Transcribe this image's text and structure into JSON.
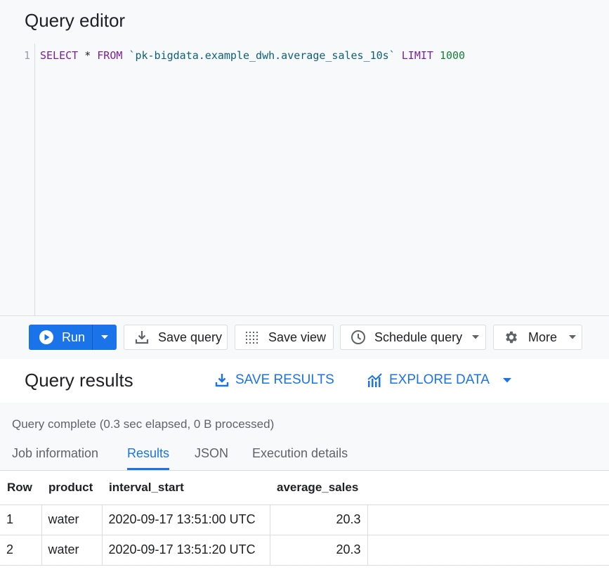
{
  "editor": {
    "title": "Query editor",
    "line_number": "1",
    "code": {
      "select": "SELECT",
      "star": "*",
      "from": "FROM",
      "table": "`pk-bigdata.example_dwh.average_sales_10s`",
      "limit": "LIMIT",
      "limit_value": "1000"
    }
  },
  "toolbar": {
    "run_label": "Run",
    "save_query_label": "Save query",
    "save_view_label": "Save view",
    "schedule_query_label": "Schedule query",
    "more_label": "More"
  },
  "results": {
    "title": "Query results",
    "save_results_label": "SAVE RESULTS",
    "explore_data_label": "EXPLORE DATA",
    "status": "Query complete (0.3 sec elapsed, 0 B processed)",
    "tabs": [
      {
        "label": "Job information"
      },
      {
        "label": "Results"
      },
      {
        "label": "JSON"
      },
      {
        "label": "Execution details"
      }
    ],
    "active_tab": "Results",
    "columns": [
      "Row",
      "product",
      "interval_start",
      "average_sales"
    ],
    "rows": [
      [
        "1",
        "water",
        "2020-09-17 13:51:00 UTC",
        "20.3"
      ],
      [
        "2",
        "water",
        "2020-09-17 13:51:20 UTC",
        "20.3"
      ]
    ]
  },
  "colors": {
    "accent": "#1a73e8",
    "keyword": "#7b1fa2",
    "string": "#0d5f7a",
    "number": "#188038"
  },
  "icons": [
    "play-icon",
    "chevron-down-icon",
    "download-icon",
    "grid-dots-icon",
    "clock-icon",
    "gear-icon",
    "chart-icon"
  ]
}
